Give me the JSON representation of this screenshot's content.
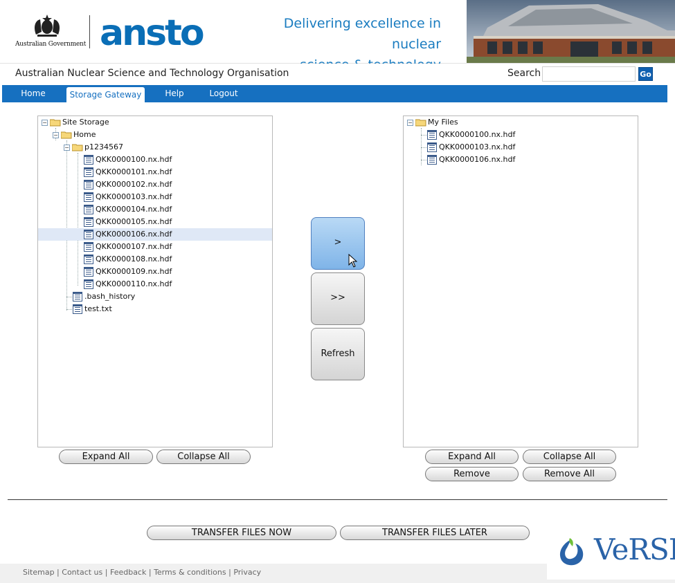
{
  "header": {
    "gov_text": "Australian Government",
    "logo_text": "ansto",
    "tagline_line1": "Delivering excellence in nuclear",
    "tagline_line2": "science & technology",
    "org_name": "Australian Nuclear Science and Technology Organisation",
    "search_label": "Search",
    "search_value": "",
    "go_label": "Go"
  },
  "nav": {
    "items": [
      "Home",
      "Storage Gateway",
      "Help",
      "Logout"
    ],
    "active": "Storage Gateway"
  },
  "left_tree": {
    "root": "Site Storage",
    "home": "Home",
    "folder": "p1234567",
    "files": [
      "QKK0000100.nx.hdf",
      "QKK0000101.nx.hdf",
      "QKK0000102.nx.hdf",
      "QKK0000103.nx.hdf",
      "QKK0000104.nx.hdf",
      "QKK0000105.nx.hdf",
      "QKK0000106.nx.hdf",
      "QKK0000107.nx.hdf",
      "QKK0000108.nx.hdf",
      "QKK0000109.nx.hdf",
      "QKK0000110.nx.hdf"
    ],
    "selected": "QKK0000106.nx.hdf",
    "home_files": [
      ".bash_history",
      "test.txt"
    ]
  },
  "right_tree": {
    "root": "My Files",
    "files": [
      "QKK0000100.nx.hdf",
      "QKK0000103.nx.hdf",
      "QKK0000106.nx.hdf"
    ]
  },
  "buttons": {
    "expand_all": "Expand All",
    "collapse_all": "Collapse All",
    "remove": "Remove",
    "remove_all": "Remove All",
    "move_one": ">",
    "move_all": ">>",
    "refresh": "Refresh",
    "transfer_now": "TRANSFER FILES NOW",
    "transfer_later": "TRANSFER FILES LATER"
  },
  "footer": {
    "links": [
      "Sitemap",
      "Contact us",
      "Feedback",
      "Terms & conditions",
      "Privacy"
    ],
    "partner_logo": "VeRSI"
  },
  "colors": {
    "brand_blue": "#0a6eb6",
    "nav_blue": "#1670c0",
    "selected_row": "#dfe8f6"
  }
}
